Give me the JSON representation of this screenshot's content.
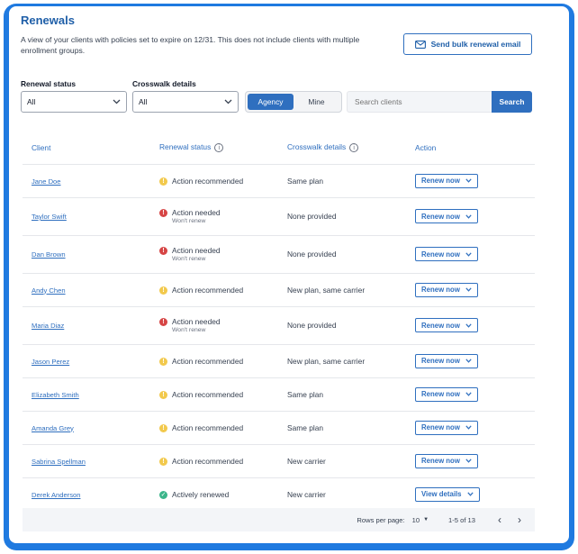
{
  "header": {
    "title": "Renewals",
    "subtitle": "A view of your clients with policies set to expire on 12/31. This does not include clients with multiple enrollment groups.",
    "bulk_button": "Send bulk renewal email",
    "bulk_icon": "mail-icon"
  },
  "filters": {
    "renewal_status_label": "Renewal status",
    "renewal_status_value": "All",
    "crosswalk_label": "Crosswalk details",
    "crosswalk_value": "All",
    "toggle_options": [
      "Agency",
      "Mine"
    ],
    "toggle_selected": "Agency",
    "search_placeholder": "Search clients",
    "search_button": "Search"
  },
  "table": {
    "columns": [
      "Client",
      "Renewal status",
      "Crosswalk details",
      "Action"
    ],
    "rows": [
      {
        "client": "Jane Doe",
        "status": "Action recommended",
        "note": "",
        "status_type": "warning",
        "crosswalk": "Same plan",
        "action": "Renew now"
      },
      {
        "client": "Taylor Swift",
        "status": "Action needed",
        "note": "Won't renew",
        "status_type": "error",
        "crosswalk": "None provided",
        "action": "Renew now"
      },
      {
        "client": "Dan Brown",
        "status": "Action needed",
        "note": "Won't renew",
        "status_type": "error",
        "crosswalk": "None provided",
        "action": "Renew now"
      },
      {
        "client": "Andy Chen",
        "status": "Action recommended",
        "note": "",
        "status_type": "warning",
        "crosswalk": "New plan, same carrier",
        "action": "Renew now"
      },
      {
        "client": "Maria Diaz",
        "status": "Action needed",
        "note": "Won't renew",
        "status_type": "error",
        "crosswalk": "None provided",
        "action": "Renew now"
      },
      {
        "client": "Jason Perez",
        "status": "Action recommended",
        "note": "",
        "status_type": "warning",
        "crosswalk": "New plan, same carrier",
        "action": "Renew now"
      },
      {
        "client": "Elizabeth Smith",
        "status": "Action recommended",
        "note": "",
        "status_type": "warning",
        "crosswalk": "Same plan",
        "action": "Renew now"
      },
      {
        "client": "Amanda Grey",
        "status": "Action recommended",
        "note": "",
        "status_type": "warning",
        "crosswalk": "Same plan",
        "action": "Renew now"
      },
      {
        "client": "Sabrina Spellman",
        "status": "Action recommended",
        "note": "",
        "status_type": "warning",
        "crosswalk": "New carrier",
        "action": "Renew now"
      },
      {
        "client": "Derek Anderson",
        "status": "Actively renewed",
        "note": "",
        "status_type": "success",
        "crosswalk": "New carrier",
        "action": "View details"
      }
    ]
  },
  "pagination": {
    "rows_per_page_label": "Rows per page:",
    "rows_per_page_value": "10",
    "range": "1-5 of 13"
  },
  "colors": {
    "frame": "#1f7ae0",
    "primary": "#2f6fbf",
    "warning": "#f2c94c",
    "error": "#d64545",
    "success": "#3bb58a"
  }
}
